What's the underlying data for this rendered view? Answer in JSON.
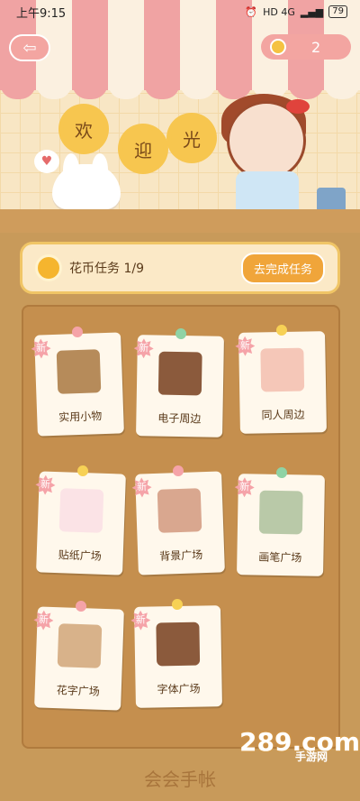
{
  "status_bar": {
    "time": "上午9:15",
    "network": "HD 4G",
    "battery": "79"
  },
  "header": {
    "back_icon": "arrow-left-icon",
    "coin_icon": "coin-icon",
    "coin_count": "2"
  },
  "hero": {
    "welcome_chars": [
      "欢",
      "迎",
      "光"
    ]
  },
  "task": {
    "label": "花币任务 1/9",
    "button": "去完成任务"
  },
  "cards": [
    {
      "badge": "新",
      "label": "实用小物",
      "art_color": "#b68b5a",
      "pin": "#f5a3a8"
    },
    {
      "badge": "新",
      "label": "电子周边",
      "art_color": "#8b5a3c",
      "pin": "#8fd3a5"
    },
    {
      "badge": "新",
      "label": "同人周边",
      "art_color": "#f5c7b8",
      "pin": "#f7d155"
    },
    {
      "badge": "新",
      "label": "贴纸广场",
      "art_color": "#fbe3e6",
      "pin": "#f7d155"
    },
    {
      "badge": "新",
      "label": "背景广场",
      "art_color": "#d9a78f",
      "pin": "#f5a3a8"
    },
    {
      "badge": "新",
      "label": "画笔广场",
      "art_color": "#b9c9a8",
      "pin": "#8fd3a5"
    },
    {
      "badge": "新",
      "label": "花字广场",
      "art_color": "#d8b28a",
      "pin": "#f5a3a8"
    },
    {
      "badge": "新",
      "label": "字体广场",
      "art_color": "#8b5a3c",
      "pin": "#f7d155"
    }
  ],
  "footer": {
    "brand": "会会手帐"
  },
  "watermark": {
    "number": "289.com",
    "text": "手游网"
  }
}
